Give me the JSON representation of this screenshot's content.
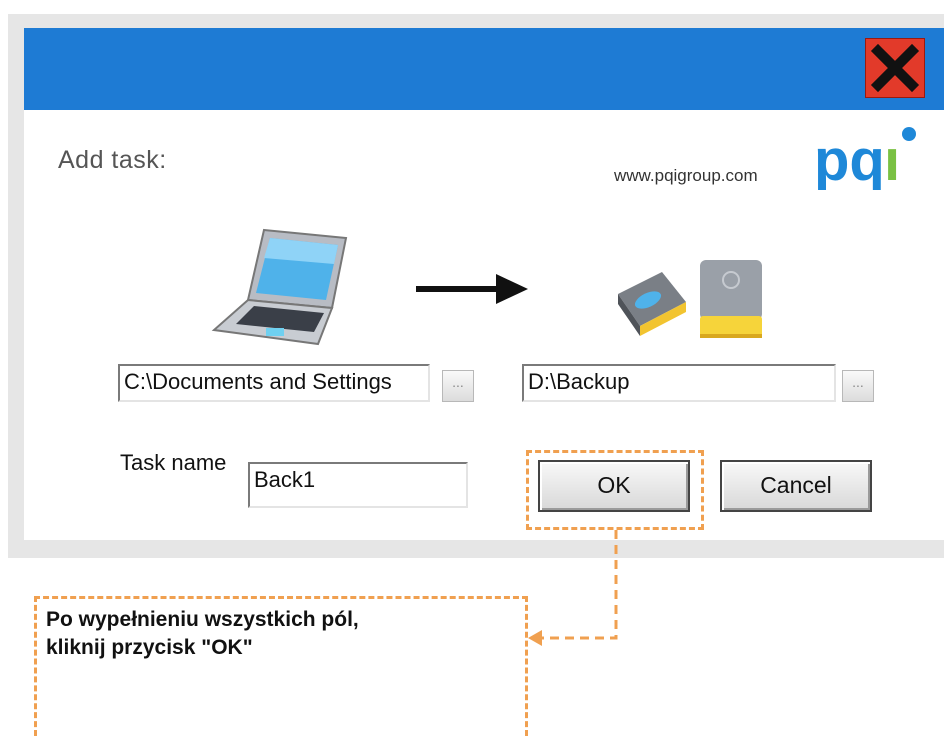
{
  "dialog": {
    "heading": "Add task:",
    "website": "www.pqigroup.com",
    "logo_text": "pqi",
    "source_path": "C:\\Documents and Settings",
    "destination_path": "D:\\Backup",
    "browse_label": "...",
    "task_name_label": "Task name",
    "task_name_value": "Back1",
    "ok_label": "OK",
    "cancel_label": "Cancel"
  },
  "annotation": {
    "line1": "Po wypełnieniu wszystkich pól,",
    "line2": "kliknij przycisk \"OK\""
  },
  "colors": {
    "titlebar": "#1e7bd4",
    "close": "#e23a2a",
    "callout": "#f0a050",
    "logo_blue": "#1e88d8",
    "logo_green": "#7ac143"
  }
}
